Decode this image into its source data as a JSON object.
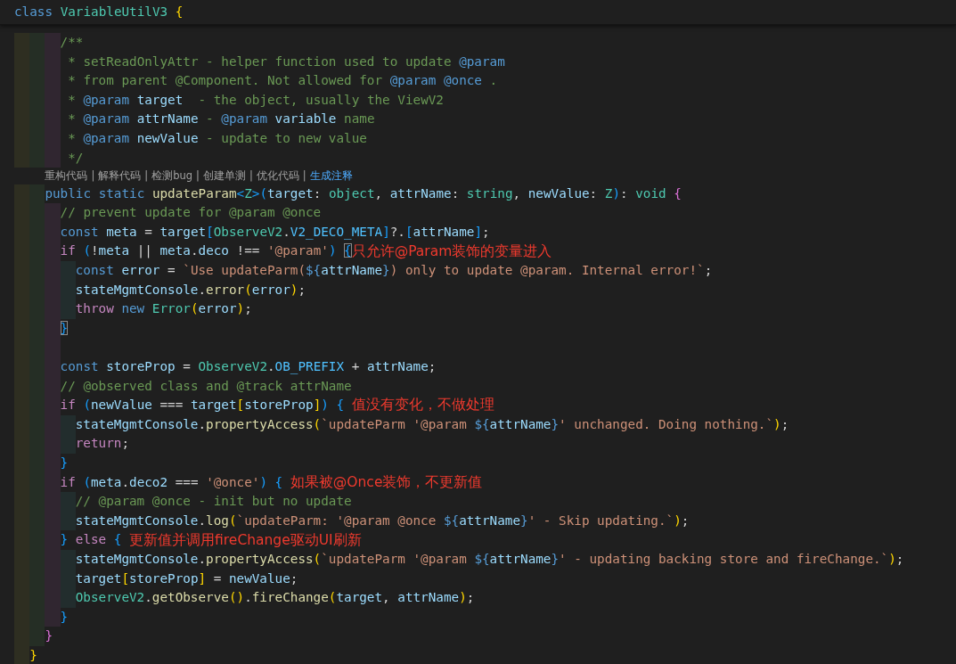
{
  "editor": {
    "sticky_header": {
      "tokens": [
        {
          "kind": "keyword",
          "text": "class "
        },
        {
          "kind": "type",
          "text": "VariableUtilV3"
        },
        {
          "kind": "bracket1",
          "text": " {"
        }
      ]
    },
    "lines": [
      {
        "kind": "group",
        "children": [
          {
            "kind": "group",
            "children": [
              {
                "kind": "group",
                "children": [
                  {
                    "kind": "code",
                    "tokens": [
                      {
                        "kind": "comment",
                        "text": "/**"
                      }
                    ]
                  },
                  {
                    "kind": "code",
                    "tokens": [
                      {
                        "kind": "comment",
                        "text": " * setReadOnlyAttr - helper function used to update "
                      },
                      {
                        "kind": "doc_tag",
                        "text": "@param"
                      }
                    ]
                  },
                  {
                    "kind": "code",
                    "tokens": [
                      {
                        "kind": "comment",
                        "text": " * from parent @Component. Not allowed for "
                      },
                      {
                        "kind": "doc_tag",
                        "text": "@param @once"
                      },
                      {
                        "kind": "comment",
                        "text": " ."
                      }
                    ]
                  },
                  {
                    "kind": "code",
                    "tokens": [
                      {
                        "kind": "comment",
                        "text": " * "
                      },
                      {
                        "kind": "doc_tag",
                        "text": "@param"
                      },
                      {
                        "kind": "variable",
                        "text": " target"
                      },
                      {
                        "kind": "comment",
                        "text": "  - the object, usually the ViewV2"
                      }
                    ]
                  },
                  {
                    "kind": "code",
                    "tokens": [
                      {
                        "kind": "comment",
                        "text": " * "
                      },
                      {
                        "kind": "doc_tag",
                        "text": "@param"
                      },
                      {
                        "kind": "variable",
                        "text": " attrName"
                      },
                      {
                        "kind": "comment",
                        "text": " - "
                      },
                      {
                        "kind": "doc_tag",
                        "text": "@param"
                      },
                      {
                        "kind": "variable",
                        "text": " variable"
                      },
                      {
                        "kind": "comment",
                        "text": " name"
                      }
                    ]
                  },
                  {
                    "kind": "code",
                    "tokens": [
                      {
                        "kind": "comment",
                        "text": " * "
                      },
                      {
                        "kind": "doc_tag",
                        "text": "@param"
                      },
                      {
                        "kind": "variable",
                        "text": " newValue"
                      },
                      {
                        "kind": "comment",
                        "text": " - update to new value"
                      }
                    ]
                  },
                  {
                    "kind": "code",
                    "tokens": [
                      {
                        "kind": "comment",
                        "text": " */"
                      }
                    ]
                  }
                ]
              },
              {
                "kind": "codelens",
                "actions": [
                  {
                    "kind": "link",
                    "text": "重构代码"
                  },
                  {
                    "kind": "separator",
                    "text": "|"
                  },
                  {
                    "kind": "link",
                    "text": "解释代码"
                  },
                  {
                    "kind": "separator",
                    "text": "|"
                  },
                  {
                    "kind": "link",
                    "text": "检测bug"
                  },
                  {
                    "kind": "separator",
                    "text": "|"
                  },
                  {
                    "kind": "link",
                    "text": "创建单测"
                  },
                  {
                    "kind": "separator",
                    "text": "|"
                  },
                  {
                    "kind": "link",
                    "text": "优化代码"
                  },
                  {
                    "kind": "separator",
                    "text": "|"
                  },
                  {
                    "kind": "link_active",
                    "text": "生成注释"
                  }
                ]
              },
              {
                "kind": "code",
                "tokens": [
                  {
                    "kind": "keyword",
                    "text": "public static "
                  },
                  {
                    "kind": "function",
                    "text": "updateParam"
                  },
                  {
                    "kind": "bracket3",
                    "text": "<"
                  },
                  {
                    "kind": "type",
                    "text": "Z"
                  },
                  {
                    "kind": "bracket3",
                    "text": ">("
                  },
                  {
                    "kind": "variable",
                    "text": "target"
                  },
                  {
                    "kind": "plain",
                    "text": ": "
                  },
                  {
                    "kind": "type",
                    "text": "object"
                  },
                  {
                    "kind": "plain",
                    "text": ", "
                  },
                  {
                    "kind": "variable",
                    "text": "attrName"
                  },
                  {
                    "kind": "plain",
                    "text": ": "
                  },
                  {
                    "kind": "type",
                    "text": "string"
                  },
                  {
                    "kind": "plain",
                    "text": ", "
                  },
                  {
                    "kind": "variable",
                    "text": "newValue"
                  },
                  {
                    "kind": "plain",
                    "text": ": "
                  },
                  {
                    "kind": "type",
                    "text": "Z"
                  },
                  {
                    "kind": "bracket3",
                    "text": ")"
                  },
                  {
                    "kind": "plain",
                    "text": ": "
                  },
                  {
                    "kind": "type",
                    "text": "void "
                  },
                  {
                    "kind": "bracket2",
                    "text": "{"
                  }
                ],
                "children": [
                  {
                    "kind": "code",
                    "tokens": [
                      {
                        "kind": "comment",
                        "text": "// prevent update for @param @once"
                      }
                    ]
                  },
                  {
                    "kind": "code",
                    "tokens": [
                      {
                        "kind": "keyword",
                        "text": "const "
                      },
                      {
                        "kind": "variable",
                        "text": "meta"
                      },
                      {
                        "kind": "plain",
                        "text": " = "
                      },
                      {
                        "kind": "variable",
                        "text": "target"
                      },
                      {
                        "kind": "bracket3",
                        "text": "["
                      },
                      {
                        "kind": "type",
                        "text": "ObserveV2"
                      },
                      {
                        "kind": "plain",
                        "text": "."
                      },
                      {
                        "kind": "constant",
                        "text": "V2_DECO_META"
                      },
                      {
                        "kind": "bracket3",
                        "text": "]"
                      },
                      {
                        "kind": "plain",
                        "text": "?."
                      },
                      {
                        "kind": "bracket3",
                        "text": "["
                      },
                      {
                        "kind": "variable",
                        "text": "attrName"
                      },
                      {
                        "kind": "bracket3",
                        "text": "]"
                      },
                      {
                        "kind": "plain",
                        "text": ";"
                      }
                    ]
                  },
                  {
                    "kind": "code",
                    "tokens": [
                      {
                        "kind": "control",
                        "text": "if "
                      },
                      {
                        "kind": "bracket3",
                        "text": "("
                      },
                      {
                        "kind": "plain",
                        "text": "!"
                      },
                      {
                        "kind": "variable",
                        "text": "meta"
                      },
                      {
                        "kind": "plain",
                        "text": " || "
                      },
                      {
                        "kind": "variable",
                        "text": "meta"
                      },
                      {
                        "kind": "plain",
                        "text": "."
                      },
                      {
                        "kind": "variable",
                        "text": "deco"
                      },
                      {
                        "kind": "plain",
                        "text": " !== "
                      },
                      {
                        "kind": "string",
                        "text": "'@param'"
                      },
                      {
                        "kind": "bracket3",
                        "text": ") "
                      },
                      {
                        "kind": "bracket_match",
                        "text": "{"
                      }
                    ],
                    "note": "只允许@Param装饰的变量进入",
                    "children": [
                      {
                        "kind": "code",
                        "tokens": [
                          {
                            "kind": "keyword",
                            "text": "const "
                          },
                          {
                            "kind": "variable",
                            "text": "error"
                          },
                          {
                            "kind": "plain",
                            "text": " = "
                          },
                          {
                            "kind": "string",
                            "text": "`Use updateParm("
                          },
                          {
                            "kind": "interp",
                            "text": "${"
                          },
                          {
                            "kind": "variable",
                            "text": "attrName"
                          },
                          {
                            "kind": "interp",
                            "text": "}"
                          },
                          {
                            "kind": "string",
                            "text": ") only to update @param. Internal error!`"
                          },
                          {
                            "kind": "plain",
                            "text": ";"
                          }
                        ]
                      },
                      {
                        "kind": "code",
                        "tokens": [
                          {
                            "kind": "variable",
                            "text": "stateMgmtConsole"
                          },
                          {
                            "kind": "plain",
                            "text": "."
                          },
                          {
                            "kind": "function",
                            "text": "error"
                          },
                          {
                            "kind": "bracket1",
                            "text": "("
                          },
                          {
                            "kind": "variable",
                            "text": "error"
                          },
                          {
                            "kind": "bracket1",
                            "text": ")"
                          },
                          {
                            "kind": "plain",
                            "text": ";"
                          }
                        ]
                      },
                      {
                        "kind": "code",
                        "tokens": [
                          {
                            "kind": "control",
                            "text": "throw "
                          },
                          {
                            "kind": "keyword",
                            "text": "new "
                          },
                          {
                            "kind": "type",
                            "text": "Error"
                          },
                          {
                            "kind": "bracket1",
                            "text": "("
                          },
                          {
                            "kind": "variable",
                            "text": "error"
                          },
                          {
                            "kind": "bracket1",
                            "text": ")"
                          },
                          {
                            "kind": "plain",
                            "text": ";"
                          }
                        ]
                      }
                    ]
                  },
                  {
                    "kind": "code",
                    "tokens": [
                      {
                        "kind": "bracket_match",
                        "text": "}"
                      }
                    ]
                  },
                  {
                    "kind": "blank"
                  },
                  {
                    "kind": "code",
                    "tokens": [
                      {
                        "kind": "keyword",
                        "text": "const "
                      },
                      {
                        "kind": "variable",
                        "text": "storeProp"
                      },
                      {
                        "kind": "plain",
                        "text": " = "
                      },
                      {
                        "kind": "type",
                        "text": "ObserveV2"
                      },
                      {
                        "kind": "plain",
                        "text": "."
                      },
                      {
                        "kind": "constant",
                        "text": "OB_PREFIX"
                      },
                      {
                        "kind": "plain",
                        "text": " + "
                      },
                      {
                        "kind": "variable",
                        "text": "attrName"
                      },
                      {
                        "kind": "plain",
                        "text": ";"
                      }
                    ]
                  },
                  {
                    "kind": "code",
                    "tokens": [
                      {
                        "kind": "comment",
                        "text": "// @observed class and @track attrName"
                      }
                    ]
                  },
                  {
                    "kind": "code",
                    "tokens": [
                      {
                        "kind": "control",
                        "text": "if "
                      },
                      {
                        "kind": "bracket3",
                        "text": "("
                      },
                      {
                        "kind": "variable",
                        "text": "newValue"
                      },
                      {
                        "kind": "plain",
                        "text": " === "
                      },
                      {
                        "kind": "variable",
                        "text": "target"
                      },
                      {
                        "kind": "bracket1",
                        "text": "["
                      },
                      {
                        "kind": "variable",
                        "text": "storeProp"
                      },
                      {
                        "kind": "bracket1",
                        "text": "]"
                      },
                      {
                        "kind": "bracket3",
                        "text": ") { "
                      }
                    ],
                    "note": "值没有变化，不做处理",
                    "children": [
                      {
                        "kind": "code",
                        "tokens": [
                          {
                            "kind": "variable",
                            "text": "stateMgmtConsole"
                          },
                          {
                            "kind": "plain",
                            "text": "."
                          },
                          {
                            "kind": "function",
                            "text": "propertyAccess"
                          },
                          {
                            "kind": "bracket1",
                            "text": "("
                          },
                          {
                            "kind": "string",
                            "text": "`updateParm '@param "
                          },
                          {
                            "kind": "interp",
                            "text": "${"
                          },
                          {
                            "kind": "variable",
                            "text": "attrName"
                          },
                          {
                            "kind": "interp",
                            "text": "}"
                          },
                          {
                            "kind": "string",
                            "text": "' unchanged. Doing nothing.`"
                          },
                          {
                            "kind": "bracket1",
                            "text": ")"
                          },
                          {
                            "kind": "plain",
                            "text": ";"
                          }
                        ]
                      },
                      {
                        "kind": "code",
                        "tokens": [
                          {
                            "kind": "control",
                            "text": "return"
                          },
                          {
                            "kind": "plain",
                            "text": ";"
                          }
                        ]
                      }
                    ]
                  },
                  {
                    "kind": "code",
                    "tokens": [
                      {
                        "kind": "bracket3",
                        "text": "}"
                      }
                    ]
                  },
                  {
                    "kind": "code",
                    "tokens": [
                      {
                        "kind": "control",
                        "text": "if "
                      },
                      {
                        "kind": "bracket3",
                        "text": "("
                      },
                      {
                        "kind": "variable",
                        "text": "meta"
                      },
                      {
                        "kind": "plain",
                        "text": "."
                      },
                      {
                        "kind": "variable",
                        "text": "deco2"
                      },
                      {
                        "kind": "plain",
                        "text": " === "
                      },
                      {
                        "kind": "string",
                        "text": "'@once'"
                      },
                      {
                        "kind": "bracket3",
                        "text": ") { "
                      }
                    ],
                    "note": "如果被@Once装饰，不更新值",
                    "children": [
                      {
                        "kind": "code",
                        "tokens": [
                          {
                            "kind": "comment",
                            "text": "// @param @once - init but no update"
                          }
                        ]
                      },
                      {
                        "kind": "code",
                        "tokens": [
                          {
                            "kind": "variable",
                            "text": "stateMgmtConsole"
                          },
                          {
                            "kind": "plain",
                            "text": "."
                          },
                          {
                            "kind": "function",
                            "text": "log"
                          },
                          {
                            "kind": "bracket1",
                            "text": "("
                          },
                          {
                            "kind": "string",
                            "text": "`updateParm: '@param @once "
                          },
                          {
                            "kind": "interp",
                            "text": "${"
                          },
                          {
                            "kind": "variable",
                            "text": "attrName"
                          },
                          {
                            "kind": "interp",
                            "text": "}"
                          },
                          {
                            "kind": "string",
                            "text": "' - Skip updating.`"
                          },
                          {
                            "kind": "bracket1",
                            "text": ")"
                          },
                          {
                            "kind": "plain",
                            "text": ";"
                          }
                        ]
                      }
                    ]
                  },
                  {
                    "kind": "code",
                    "tokens": [
                      {
                        "kind": "bracket3",
                        "text": "} "
                      },
                      {
                        "kind": "control",
                        "text": "else"
                      },
                      {
                        "kind": "bracket3",
                        "text": " { "
                      }
                    ],
                    "note": "更新值并调用fireChange驱动UI刷新",
                    "children": [
                      {
                        "kind": "code",
                        "tokens": [
                          {
                            "kind": "variable",
                            "text": "stateMgmtConsole"
                          },
                          {
                            "kind": "plain",
                            "text": "."
                          },
                          {
                            "kind": "function",
                            "text": "propertyAccess"
                          },
                          {
                            "kind": "bracket1",
                            "text": "("
                          },
                          {
                            "kind": "string",
                            "text": "`updateParm '@param "
                          },
                          {
                            "kind": "interp",
                            "text": "${"
                          },
                          {
                            "kind": "variable",
                            "text": "attrName"
                          },
                          {
                            "kind": "interp",
                            "text": "}"
                          },
                          {
                            "kind": "string",
                            "text": "' - updating backing store and fireChange.`"
                          },
                          {
                            "kind": "bracket1",
                            "text": ")"
                          },
                          {
                            "kind": "plain",
                            "text": ";"
                          }
                        ]
                      },
                      {
                        "kind": "code",
                        "tokens": [
                          {
                            "kind": "variable",
                            "text": "target"
                          },
                          {
                            "kind": "bracket1",
                            "text": "["
                          },
                          {
                            "kind": "variable",
                            "text": "storeProp"
                          },
                          {
                            "kind": "bracket1",
                            "text": "]"
                          },
                          {
                            "kind": "plain",
                            "text": " = "
                          },
                          {
                            "kind": "variable",
                            "text": "newValue"
                          },
                          {
                            "kind": "plain",
                            "text": ";"
                          }
                        ]
                      },
                      {
                        "kind": "code",
                        "tokens": [
                          {
                            "kind": "type",
                            "text": "ObserveV2"
                          },
                          {
                            "kind": "plain",
                            "text": "."
                          },
                          {
                            "kind": "function",
                            "text": "getObserve"
                          },
                          {
                            "kind": "bracket1",
                            "text": "()"
                          },
                          {
                            "kind": "plain",
                            "text": "."
                          },
                          {
                            "kind": "function",
                            "text": "fireChange"
                          },
                          {
                            "kind": "bracket1",
                            "text": "("
                          },
                          {
                            "kind": "variable",
                            "text": "target"
                          },
                          {
                            "kind": "plain",
                            "text": ", "
                          },
                          {
                            "kind": "variable",
                            "text": "attrName"
                          },
                          {
                            "kind": "bracket1",
                            "text": ")"
                          },
                          {
                            "kind": "plain",
                            "text": ";"
                          }
                        ]
                      }
                    ]
                  },
                  {
                    "kind": "code",
                    "tokens": [
                      {
                        "kind": "bracket3",
                        "text": "}"
                      }
                    ]
                  }
                ]
              },
              {
                "kind": "code",
                "tokens": [
                  {
                    "kind": "bracket2",
                    "text": "}"
                  }
                ]
              }
            ]
          },
          {
            "kind": "code",
            "tokens": [
              {
                "kind": "bracket1",
                "text": "}"
              }
            ]
          }
        ]
      }
    ]
  }
}
